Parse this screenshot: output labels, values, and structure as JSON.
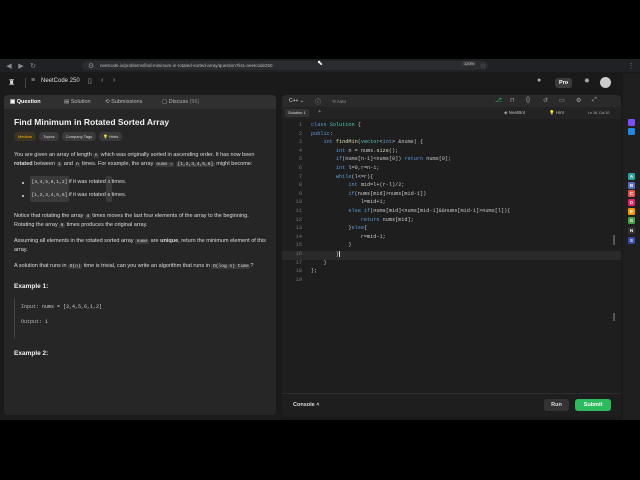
{
  "browser": {
    "url": "neetcode.io/problems/find-minimum-in-rotated-sorted-array/question?list=neetcode250",
    "zoom": "120%"
  },
  "header": {
    "course": "NeetCode 250",
    "pro_label": "Pro"
  },
  "tabs": [
    {
      "label": "Question"
    },
    {
      "label": "Solution"
    },
    {
      "label": "Submissions"
    },
    {
      "label": "Discuss",
      "count": "(56)"
    }
  ],
  "problem": {
    "title": "Find Minimum in Rotated Sorted Array",
    "chips": [
      "Medium",
      "Topics",
      "Company Tags",
      "Hints"
    ],
    "p1_a": "You are given an array of length ",
    "p1_n": "n",
    "p1_b": " which was originally sorted in ascending order. It has now been ",
    "p1_bold": "rotated",
    "p1_c": " between ",
    "p1_1": "1",
    "p1_d": " and ",
    "p1_n2": "n",
    "p1_e": " times. For example, the array ",
    "p1_nums": "nums =",
    "p1_arr": "[1,2,3,4,5,6]",
    "p1_f": " might become:",
    "bullets": [
      {
        "code": "[3,4,5,6,1,2]",
        "text": " if it was rotated ",
        "k": "4",
        "end": " times."
      },
      {
        "code": "[1,2,3,4,5,6]",
        "text": " if it was rotated ",
        "k": "6",
        "end": " times."
      }
    ],
    "p2_a": "Notice that rotating the array ",
    "p2_4": "4",
    "p2_b": " times moves the last four elements of the array to the beginning. Rotating the array ",
    "p2_6": "6",
    "p2_c": " times produces the original array.",
    "p3_a": "Assuming all elements in the rotated sorted array ",
    "p3_nums": "nums",
    "p3_b": " are ",
    "p3_bold": "unique",
    "p3_c": ", return the minimum element of this array.",
    "p4_a": "A solution that runs in ",
    "p4_on": "O(n)",
    "p4_b": " time is trivial, can you write an algorithm that runs in ",
    "p4_ologn": "O(log n) time",
    "p4_c": "?",
    "example1_title": "Example 1:",
    "example1_input_label": "Input:",
    "example1_input": "nums = [3,4,5,6,1,2]",
    "example1_output_label": "Output:",
    "example1_output": "1",
    "example2_title": "Example 2:"
  },
  "editor": {
    "language": "C++",
    "auto_label": "Auto",
    "solution_tab": "Solution 1",
    "plus": "+",
    "neetbot": "NeetBot",
    "hint": "Hint",
    "position": "Ln 16, Col 10",
    "lines": [
      "class Solution {",
      "public:",
      "    int findMin(vector<int> &nums) {",
      "        int n = nums.size();",
      "        if(nums[n-1]<nums[0]) return nums[0];",
      "        int l=0,r=n-1;",
      "        while(l<=r){",
      "            int mid=l+(r-l)/2;",
      "            if(nums[mid]>nums[mid-1])",
      "                l=mid+1;",
      "            else if(nums[mid]<nums[mid-1]&&nums[mid-1]>nums[l]){",
      "                return nums[mid];",
      "            }else{",
      "                r=mid-1;",
      "            }",
      "        }",
      "    }",
      "};",
      ""
    ],
    "console_label": "Console",
    "run_label": "Run",
    "submit_label": "Submit"
  },
  "extensions": [
    {
      "name": "ext-purple",
      "color": "#7c4dff",
      "letter": ""
    },
    {
      "name": "ext-blue",
      "color": "#1e88e5",
      "letter": ""
    },
    {
      "name": "ext-a",
      "color": "#26a69a",
      "letter": "A"
    },
    {
      "name": "ext-b",
      "color": "#5c6bc0",
      "letter": "B"
    },
    {
      "name": "ext-c",
      "color": "#ef5350",
      "letter": "C"
    },
    {
      "name": "ext-d",
      "color": "#e91e63",
      "letter": "D"
    },
    {
      "name": "ext-e",
      "color": "#ff9800",
      "letter": "E"
    },
    {
      "name": "ext-g",
      "color": "#43a047",
      "letter": "G"
    },
    {
      "name": "ext-n",
      "color": "#333333",
      "letter": "N"
    },
    {
      "name": "ext-s",
      "color": "#3949ab",
      "letter": "S"
    }
  ]
}
